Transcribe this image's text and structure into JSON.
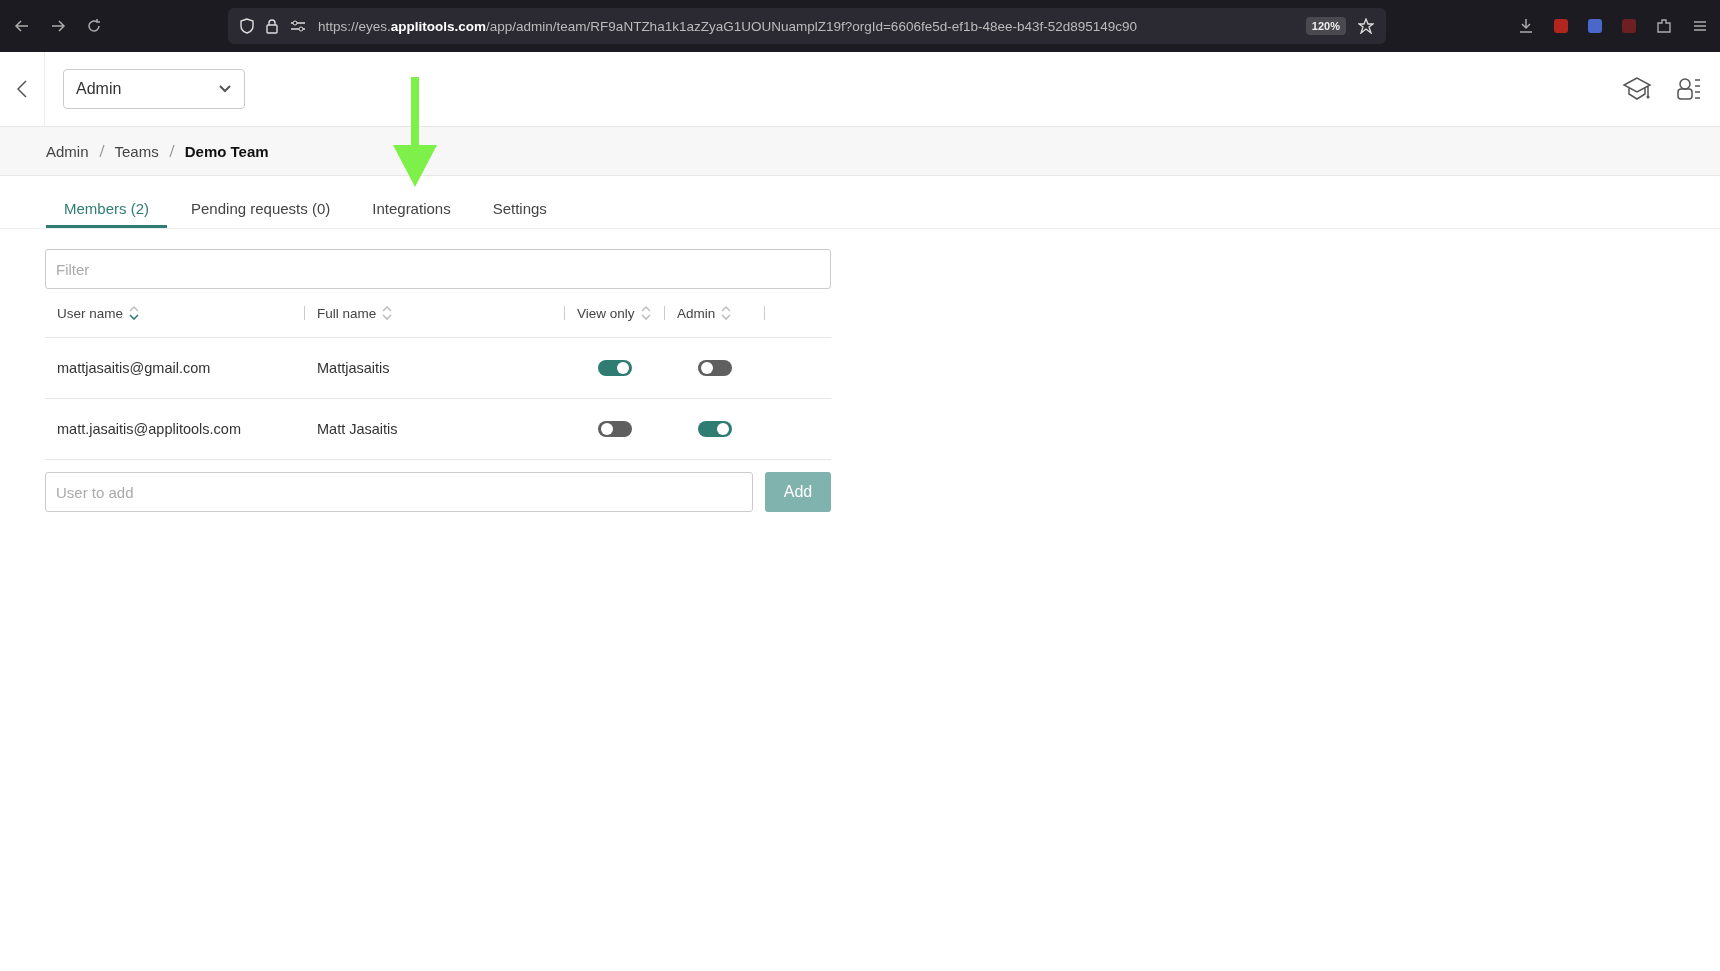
{
  "browser": {
    "url": "https://eyes.**applitools.com**/app/admin/team/RF9aNTZha1k1azZyaG1UOUNuamplZ19f?orgId=6606fe5d-ef1b-48ee-b43f-52d895149c90",
    "zoom": "120%"
  },
  "header": {
    "dropdown": "Admin"
  },
  "breadcrumb": [
    {
      "label": "Admin",
      "current": false
    },
    {
      "label": "Teams",
      "current": false
    },
    {
      "label": "Demo Team",
      "current": true
    }
  ],
  "tabs": [
    {
      "label": "Members (2)",
      "selected": true
    },
    {
      "label": "Pending requests (0)",
      "selected": false
    },
    {
      "label": "Integrations",
      "selected": false
    },
    {
      "label": "Settings",
      "selected": false
    }
  ],
  "filter": {
    "placeholder": "Filter"
  },
  "table": {
    "columns": [
      {
        "label": "User name",
        "sorted": true
      },
      {
        "label": "Full name",
        "sorted": false
      },
      {
        "label": "View only",
        "sorted": false
      },
      {
        "label": "Admin",
        "sorted": false
      }
    ],
    "rows": [
      {
        "user": "mattjasaitis@gmail.com",
        "name": "Mattjasaitis",
        "view_only": true,
        "admin": false
      },
      {
        "user": "matt.jasaitis@applitools.com",
        "name": "Matt Jasaitis",
        "view_only": false,
        "admin": true
      }
    ]
  },
  "add_user": {
    "placeholder": "User to add",
    "button": "Add",
    "disabled": true
  },
  "annotation": {
    "kind": "arrow"
  }
}
